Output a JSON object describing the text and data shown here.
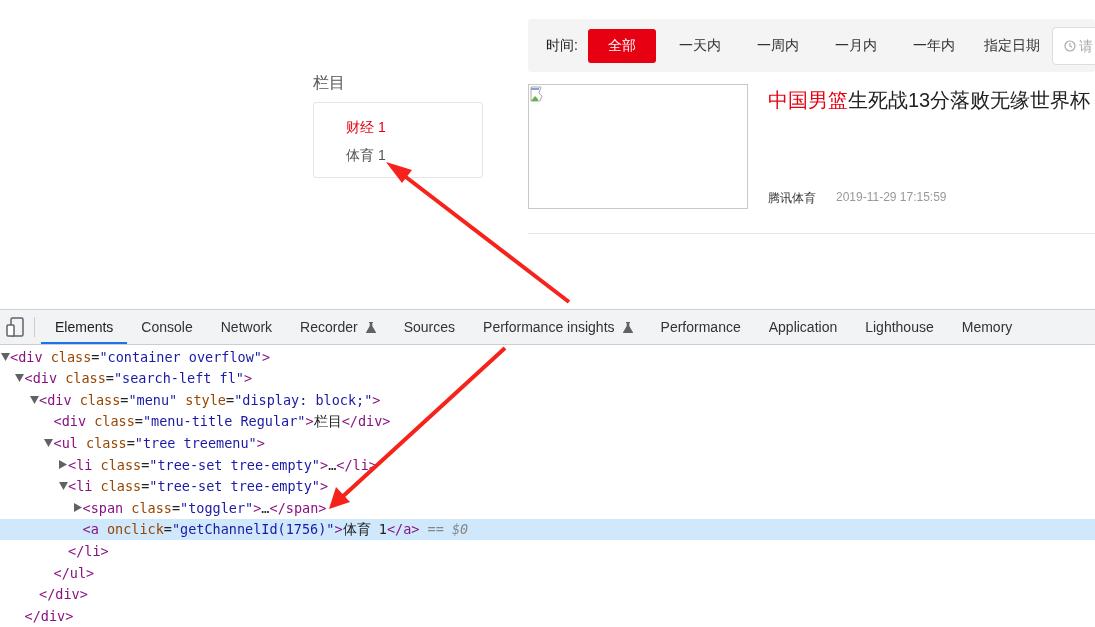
{
  "page": {
    "filter_bar": {
      "label": "时间:",
      "options": [
        {
          "label": "全部",
          "selected": true
        },
        {
          "label": "一天内",
          "selected": false
        },
        {
          "label": "一周内",
          "selected": false
        },
        {
          "label": "一月内",
          "selected": false
        },
        {
          "label": "一年内",
          "selected": false
        },
        {
          "label": "指定日期",
          "selected": false
        }
      ],
      "date_field": {
        "placeholder": "请"
      }
    },
    "menu": {
      "title": "栏目",
      "items": [
        {
          "label": "财经 1",
          "selected": true
        },
        {
          "label": "体育 1",
          "selected": false
        }
      ]
    },
    "news": [
      {
        "image": {
          "kind": "broken-image"
        },
        "title_highlight": "中国男篮",
        "title_rest": "生死战13分落败无缘世界杯",
        "source": "腾讯体育",
        "time": "2019-11-29 17:15:59"
      }
    ]
  },
  "devtools": {
    "tabs": [
      {
        "label": "Elements",
        "selected": true,
        "experimental": false
      },
      {
        "label": "Console",
        "selected": false,
        "experimental": false
      },
      {
        "label": "Network",
        "selected": false,
        "experimental": false
      },
      {
        "label": "Recorder",
        "selected": false,
        "experimental": true
      },
      {
        "label": "Sources",
        "selected": false,
        "experimental": false
      },
      {
        "label": "Performance insights",
        "selected": false,
        "experimental": true
      },
      {
        "label": "Performance",
        "selected": false,
        "experimental": false
      },
      {
        "label": "Application",
        "selected": false,
        "experimental": false
      },
      {
        "label": "Lighthouse",
        "selected": false,
        "experimental": false
      },
      {
        "label": "Memory",
        "selected": false,
        "experimental": false
      }
    ],
    "dom_tree": [
      {
        "expanded": true,
        "selected": false,
        "parts": [
          {
            "kind": "tag",
            "text": "<div"
          },
          {
            "kind": "attr",
            "text": " class"
          },
          {
            "kind": "text",
            "text": "="
          },
          {
            "kind": "value",
            "text": "\"container overflow\""
          },
          {
            "kind": "tag",
            "text": ">"
          }
        ],
        "children": [
          {
            "expanded": true,
            "selected": false,
            "parts": [
              {
                "kind": "tag",
                "text": "<div"
              },
              {
                "kind": "attr",
                "text": " class"
              },
              {
                "kind": "text",
                "text": "="
              },
              {
                "kind": "value",
                "text": "\"search-left fl\""
              },
              {
                "kind": "tag",
                "text": ">"
              }
            ],
            "closing": "</div>",
            "children": [
              {
                "expanded": true,
                "selected": false,
                "parts": [
                  {
                    "kind": "tag",
                    "text": "<div"
                  },
                  {
                    "kind": "attr",
                    "text": " class"
                  },
                  {
                    "kind": "text",
                    "text": "="
                  },
                  {
                    "kind": "value",
                    "text": "\"menu\""
                  },
                  {
                    "kind": "attr",
                    "text": " style"
                  },
                  {
                    "kind": "text",
                    "text": "="
                  },
                  {
                    "kind": "value",
                    "text": "\"display: block;\""
                  },
                  {
                    "kind": "tag",
                    "text": ">"
                  }
                ],
                "closing": "</div>",
                "children": [
                  {
                    "selected": false,
                    "parts": [
                      {
                        "kind": "tag",
                        "text": "<div"
                      },
                      {
                        "kind": "attr",
                        "text": " class"
                      },
                      {
                        "kind": "text",
                        "text": "="
                      },
                      {
                        "kind": "value",
                        "text": "\"menu-title Regular\""
                      },
                      {
                        "kind": "tag",
                        "text": ">"
                      },
                      {
                        "kind": "text",
                        "text": "栏目"
                      },
                      {
                        "kind": "tag",
                        "text": "</div>"
                      }
                    ]
                  },
                  {
                    "expanded": true,
                    "selected": false,
                    "parts": [
                      {
                        "kind": "tag",
                        "text": "<ul"
                      },
                      {
                        "kind": "attr",
                        "text": " class"
                      },
                      {
                        "kind": "text",
                        "text": "="
                      },
                      {
                        "kind": "value",
                        "text": "\"tree treemenu\""
                      },
                      {
                        "kind": "tag",
                        "text": ">"
                      }
                    ],
                    "closing": "</ul>",
                    "children": [
                      {
                        "expanded": false,
                        "selected": false,
                        "parts": [
                          {
                            "kind": "tag",
                            "text": "<li"
                          },
                          {
                            "kind": "attr",
                            "text": " class"
                          },
                          {
                            "kind": "text",
                            "text": "="
                          },
                          {
                            "kind": "value",
                            "text": "\"tree-set tree-empty\""
                          },
                          {
                            "kind": "tag",
                            "text": ">"
                          },
                          {
                            "kind": "text",
                            "text": "…"
                          },
                          {
                            "kind": "tag",
                            "text": "</li>"
                          }
                        ]
                      },
                      {
                        "expanded": true,
                        "selected": false,
                        "parts": [
                          {
                            "kind": "tag",
                            "text": "<li"
                          },
                          {
                            "kind": "attr",
                            "text": " class"
                          },
                          {
                            "kind": "text",
                            "text": "="
                          },
                          {
                            "kind": "value",
                            "text": "\"tree-set tree-empty\""
                          },
                          {
                            "kind": "tag",
                            "text": ">"
                          }
                        ],
                        "closing": "</li>",
                        "children": [
                          {
                            "expanded": false,
                            "selected": false,
                            "parts": [
                              {
                                "kind": "tag",
                                "text": "<span"
                              },
                              {
                                "kind": "attr",
                                "text": " class"
                              },
                              {
                                "kind": "text",
                                "text": "="
                              },
                              {
                                "kind": "value",
                                "text": "\"toggler\""
                              },
                              {
                                "kind": "tag",
                                "text": ">"
                              },
                              {
                                "kind": "text",
                                "text": "…"
                              },
                              {
                                "kind": "tag",
                                "text": "</span>"
                              }
                            ]
                          },
                          {
                            "selected": true,
                            "parts": [
                              {
                                "kind": "tag",
                                "text": "<a"
                              },
                              {
                                "kind": "attr",
                                "text": " onclick"
                              },
                              {
                                "kind": "text",
                                "text": "="
                              },
                              {
                                "kind": "value",
                                "text": "\"getChannelId(1756)\""
                              },
                              {
                                "kind": "tag",
                                "text": ">"
                              },
                              {
                                "kind": "text",
                                "text": "体育 1"
                              },
                              {
                                "kind": "tag",
                                "text": "</a>"
                              },
                              {
                                "kind": "hint",
                                "text": " == $0"
                              }
                            ]
                          }
                        ]
                      }
                    ]
                  }
                ]
              }
            ]
          }
        ]
      }
    ]
  }
}
